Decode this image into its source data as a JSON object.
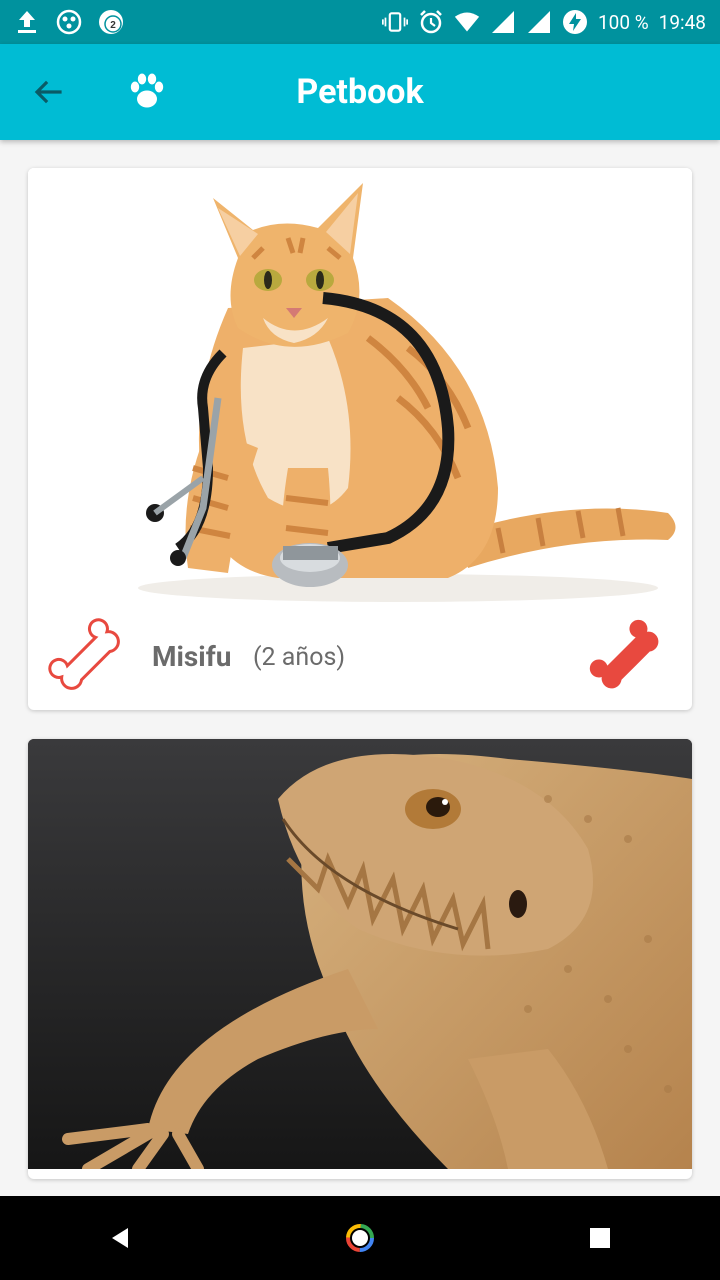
{
  "status_bar": {
    "battery": "100 %",
    "time": "19:48",
    "notification_count": "2",
    "icons": [
      "upload-icon",
      "dots-icon",
      "badge-icon",
      "vibrate-icon",
      "alarm-icon",
      "wifi-icon",
      "signal-icon",
      "signal-icon-2",
      "battery-charging-icon"
    ]
  },
  "app_bar": {
    "title": "Petbook",
    "back_icon": "arrow-back-icon",
    "logo_icon": "paw-icon"
  },
  "pets": [
    {
      "name": "Misifu",
      "age": "(2 años)",
      "photo": "cat-with-stethoscope",
      "like_icon": "bone-outline-icon",
      "rate_icon": "bone-filled-icon"
    },
    {
      "photo": "bearded-dragon"
    }
  ],
  "colors": {
    "status_bar": "#00929e",
    "app_bar": "#00bcd4",
    "bone": "#e8493f",
    "name_text": "#6b6b6b"
  },
  "nav": [
    "back-triangle-icon",
    "home-circle-icon",
    "recents-square-icon"
  ]
}
